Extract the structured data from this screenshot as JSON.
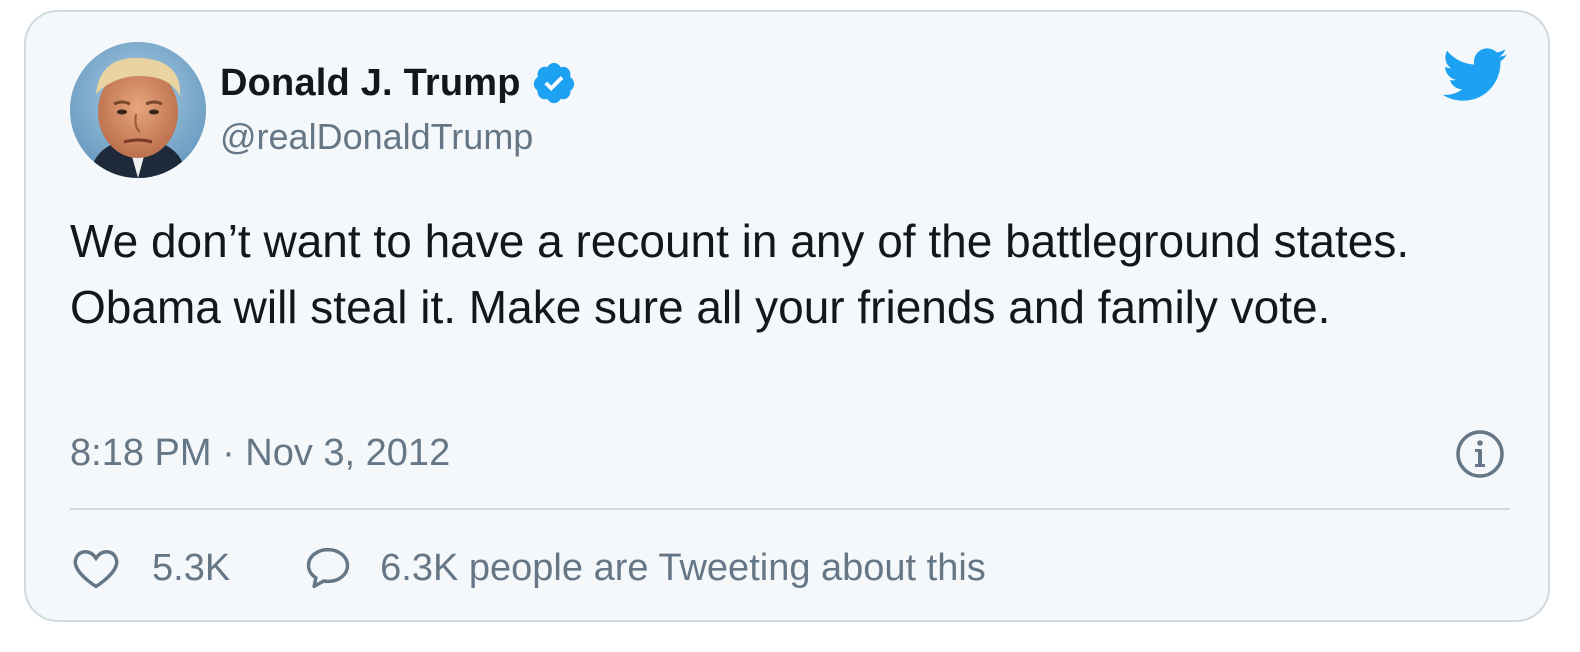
{
  "author": {
    "display_name": "Donald J. Trump",
    "handle": "@realDonaldTrump",
    "verified": true,
    "avatar_icon": "profile-photo"
  },
  "tweet": {
    "text": "We don’t want to have a recount in any of the battleground states. Obama will steal it. Make sure all your friends and family vote.",
    "timestamp": "8:18 PM · Nov 3, 2012"
  },
  "engagement": {
    "likes": "5.3K",
    "tweeting_about": "6.3K people are Tweeting about this"
  },
  "colors": {
    "brand_blue": "#1da1f2",
    "text_primary": "#14171a",
    "text_secondary": "#657786",
    "border": "#cfd9de",
    "card_bg": "#f5f8fa"
  },
  "icons": {
    "brand": "twitter-bird-icon",
    "verified": "verified-badge-icon",
    "info": "info-icon",
    "like": "heart-icon",
    "reply": "speech-bubble-icon"
  }
}
